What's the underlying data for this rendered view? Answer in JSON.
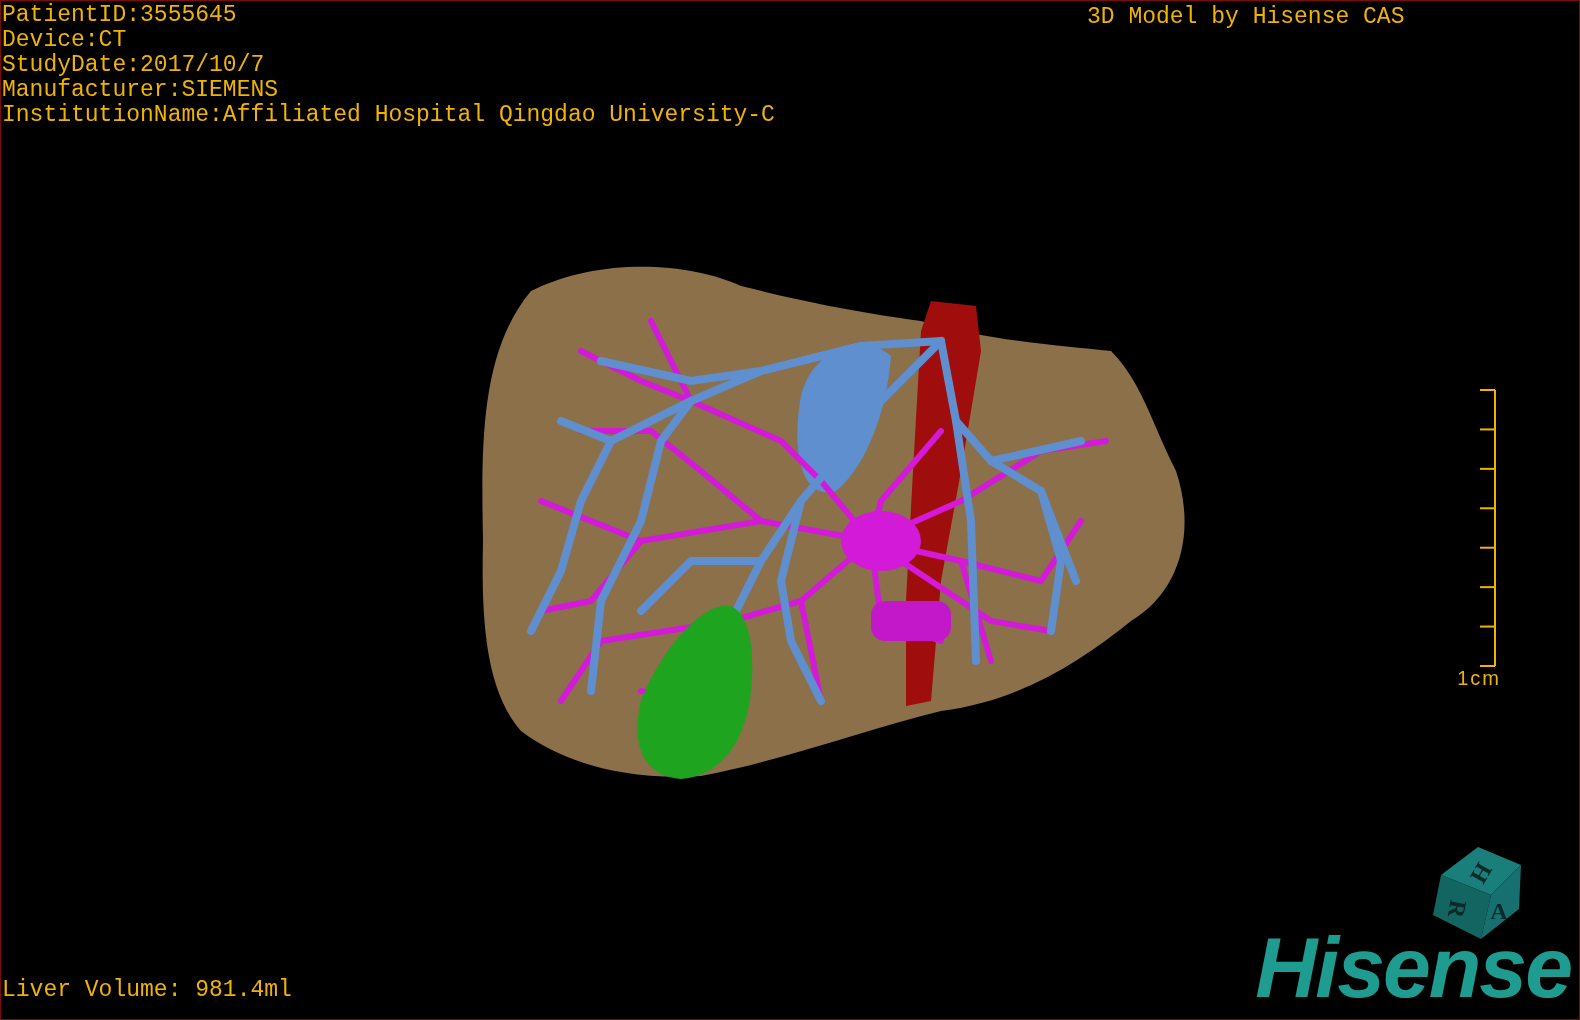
{
  "viewer": {
    "patient_info": [
      "PatientID:3555645",
      "Device:CT",
      "StudyDate:2017/10/7",
      "Manufacturer:SIEMENS",
      "InstitutionName:Affiliated Hospital Qingdao University-C"
    ],
    "model_credit": "3D Model by Hisense CAS",
    "scale_bar": {
      "label": "1cm"
    },
    "orientation_cube": {
      "faces": [
        "H",
        "R",
        "A"
      ]
    },
    "logo": "Hisense",
    "liver_volume": "Liver Volume: 981.4ml"
  }
}
